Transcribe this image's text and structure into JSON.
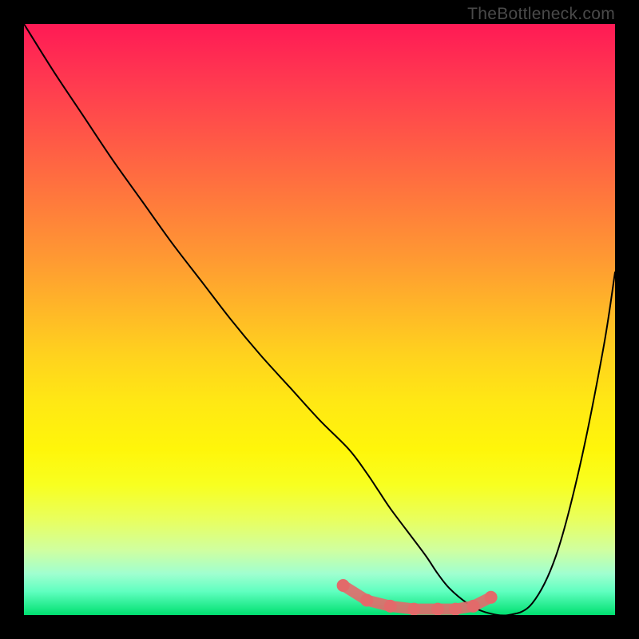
{
  "watermark": "TheBottleneck.com",
  "chart_data": {
    "type": "line",
    "title": "",
    "xlabel": "",
    "ylabel": "",
    "xlim": [
      0,
      100
    ],
    "ylim": [
      0,
      100
    ],
    "series": [
      {
        "name": "curve",
        "x": [
          0,
          5,
          10,
          15,
          20,
          25,
          30,
          35,
          40,
          45,
          50,
          55,
          58,
          60,
          62,
          65,
          68,
          70,
          72,
          75,
          78,
          82,
          86,
          90,
          94,
          98,
          100
        ],
        "values": [
          100,
          92,
          84.5,
          77,
          70,
          63,
          56.5,
          50,
          44,
          38.5,
          33,
          28,
          24,
          21,
          18,
          14,
          10,
          7,
          4.5,
          2,
          0.5,
          0,
          2,
          10,
          25,
          45,
          58
        ]
      }
    ],
    "markers": {
      "name": "bottom-dots",
      "color": "#e26a6a",
      "x": [
        54,
        58,
        62,
        66,
        70,
        73,
        76,
        79
      ],
      "values": [
        5,
        2.5,
        1.5,
        1,
        1,
        1,
        1.5,
        3
      ]
    },
    "background_gradient": {
      "stops": [
        {
          "pos": 0,
          "color": "#ff1a55"
        },
        {
          "pos": 50,
          "color": "#ffb628"
        },
        {
          "pos": 78,
          "color": "#f8ff20"
        },
        {
          "pos": 100,
          "color": "#00e070"
        }
      ]
    }
  }
}
